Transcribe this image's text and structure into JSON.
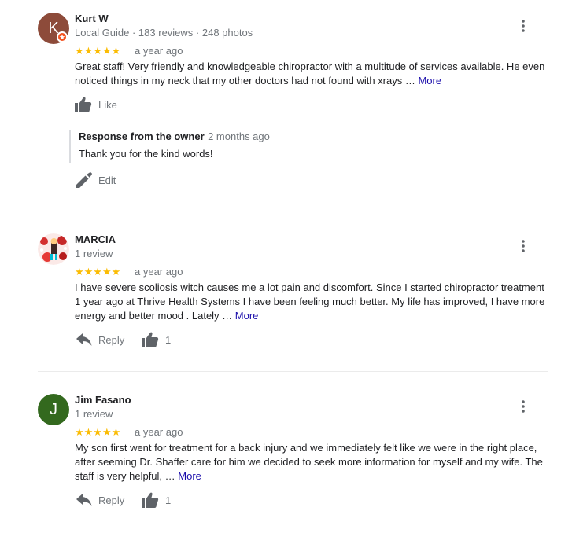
{
  "reviews": [
    {
      "avatar_letter": "K",
      "avatar_color": "#8d4b3a",
      "name": "Kurt W",
      "meta": "Local Guide · 183 reviews · 248 photos",
      "stars": "★★★★★",
      "rating": 5,
      "age": "a year ago",
      "text": "Great staff! Very friendly and knowledgeable chiropractor with a multitude of services available. He even noticed things in my neck that my other doctors had not found with xrays … ",
      "more": "More",
      "like_label": "Like",
      "owner_response": {
        "title": "Response from the owner",
        "age": "2 months ago",
        "text": "Thank you for the kind words!",
        "edit_label": "Edit"
      }
    },
    {
      "name": "MARCIA",
      "meta": "1 review",
      "stars": "★★★★★",
      "rating": 5,
      "age": "a year ago",
      "text": "I have severe scoliosis witch causes me a lot pain and discomfort. Since I started chiropractor treatment 1 year ago at Thrive Health Systems I have been feeling much better. My life has improved, I have more energy and better mood . Lately … ",
      "more": "More",
      "reply_label": "Reply",
      "like_count": "1"
    },
    {
      "avatar_letter": "J",
      "avatar_color": "#33691e",
      "name": "Jim Fasano",
      "meta": "1 review",
      "stars": "★★★★★",
      "rating": 5,
      "age": "a year ago",
      "text": "My son first went for treatment for a back injury and we immediately felt like we were in the right place, after seeming Dr. Shaffer care for him we decided to seek more information for myself and my wife.  The staff is very helpful, … ",
      "more": "More",
      "reply_label": "Reply",
      "like_count": "1"
    }
  ]
}
